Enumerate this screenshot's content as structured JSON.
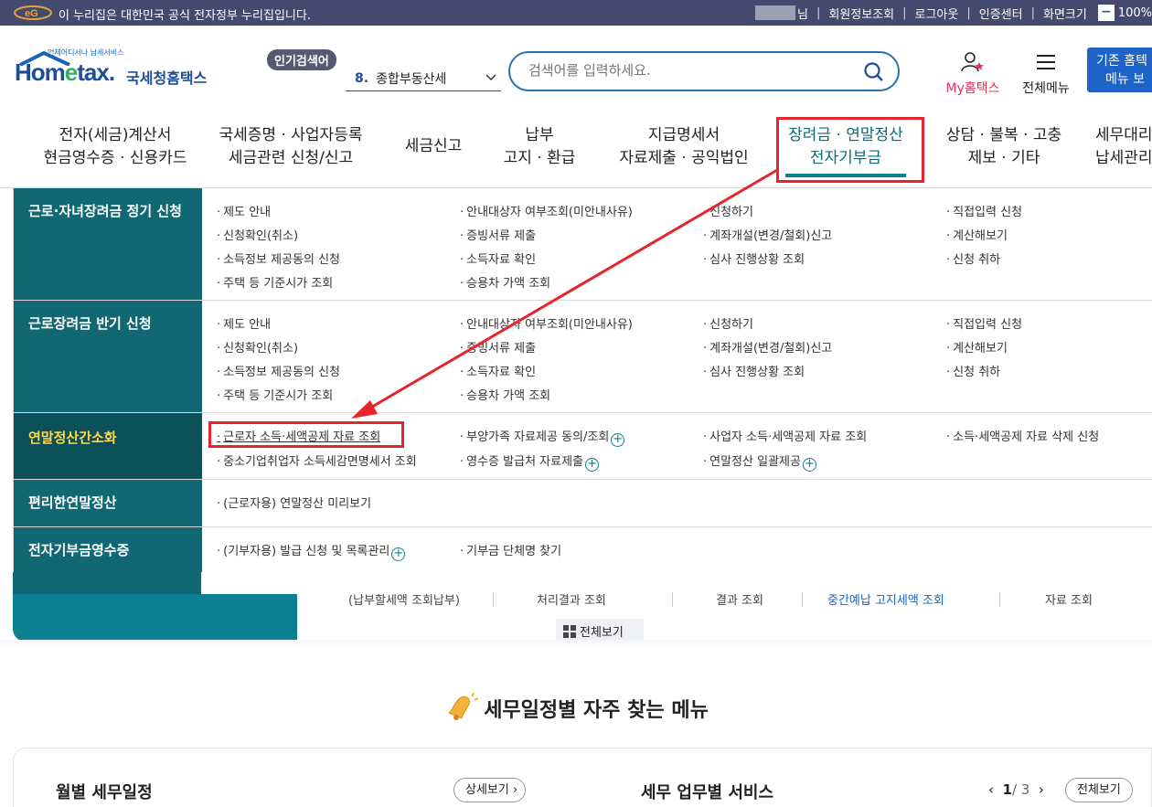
{
  "gov_banner": {
    "text": "이 누리집은 대한민국 공식 전자정부 누리집입니다.",
    "logo_text": "eG",
    "user_suffix": "님",
    "links": [
      "회원정보조회",
      "로그아웃",
      "인증센터",
      "화면크기"
    ],
    "zoom": "100%"
  },
  "header": {
    "logo_small": "언제어디서나 납세서비스",
    "logo_home": "Hom",
    "logo_e": "e",
    "logo_tax": "tax.",
    "logo_kor": "국세청홈택스",
    "popular_label": "인기검색어",
    "popular_num": "8.",
    "popular_term": "종합부동산세",
    "search_placeholder": "검색어를 입력하세요.",
    "my_hometax": "My홈택스",
    "all_menu": "전체메뉴",
    "old_menu_line1": "기존 홈텍",
    "old_menu_line2": "메뉴 보"
  },
  "gnb": [
    {
      "l1": "전자(세금)계산서",
      "l2": "현금영수증 · 신용카드"
    },
    {
      "l1": "국세증명 · 사업자등록",
      "l2": "세금관련 신청/신고"
    },
    {
      "l1": "세금신고",
      "l2": ""
    },
    {
      "l1": "납부",
      "l2": "고지 · 환급"
    },
    {
      "l1": "지급명세서",
      "l2": "자료제출 · 공익법인"
    },
    {
      "l1": "장려금 · 연말정산",
      "l2": "전자기부금"
    },
    {
      "l1": "상담 · 불복 · 고충",
      "l2": "제보 · 기타"
    },
    {
      "l1": "세무대리",
      "l2": "납세관리"
    }
  ],
  "mega": {
    "sections": [
      {
        "title": "근로·자녀장려금 정기 신청",
        "links": [
          "제도 안내",
          "안내대상자 여부조회(미안내사유)",
          "신청하기",
          "직접입력 신청",
          "신청확인(취소)",
          "증빙서류 제출",
          "계좌개설(변경/철회)신고",
          "계산해보기",
          "소득정보 제공동의 신청",
          "소득자료 확인",
          "심사 진행상황 조회",
          "신청 취하",
          "주택 등 기준시가 조회",
          "승용차 가액 조회"
        ]
      },
      {
        "title": "근로장려금 반기 신청",
        "links": [
          "제도 안내",
          "안내대상자 여부조회(미안내사유)",
          "신청하기",
          "직접입력 신청",
          "신청확인(취소)",
          "증빙서류 제출",
          "계좌개설(변경/철회)신고",
          "계산해보기",
          "소득정보 제공동의 신청",
          "소득자료 확인",
          "심사 진행상황 조회",
          "신청 취하",
          "주택 등 기준시가 조회",
          "승용차 가액 조회"
        ]
      },
      {
        "title": "연말정산간소화",
        "links": [
          "근로자 소득·세액공제 자료 조회",
          "부양가족 자료제공 동의/조회",
          "사업자 소득·세액공제 자료 조회",
          "소득·세액공제 자료 삭제 신청",
          "중소기업취업자 소득세감면명세서 조회",
          "영수증 발급처 자료제출",
          "연말정산 일괄제공"
        ]
      },
      {
        "title": "편리한연말정산",
        "links": [
          "(근로자용) 연말정산 미리보기"
        ]
      },
      {
        "title": "전자기부금영수증",
        "links": [
          "(기부자용) 발급 신청 및 목록관리",
          "기부금 단체명 찾기"
        ]
      }
    ]
  },
  "behind": {
    "tabs": [
      "(납부할세액 조회납부)",
      "처리결과 조회",
      "결과 조회",
      "중간예납 고지세액 조회",
      "자료 조회"
    ],
    "view_all": "전체보기",
    "section_title": "세무일정별 자주 찾는 메뉴",
    "monthly": "월별 세무일정",
    "detail_btn": "상세보기",
    "services": "세무 업무별 서비스",
    "page_current": "1",
    "page_total": "/ 3",
    "view_all_btn": "전체보기"
  },
  "colors": {
    "teal": "#116873",
    "teal_dark": "#0b4f58",
    "highlight_red": "#e5252b",
    "gov_bar": "#434a6e"
  }
}
